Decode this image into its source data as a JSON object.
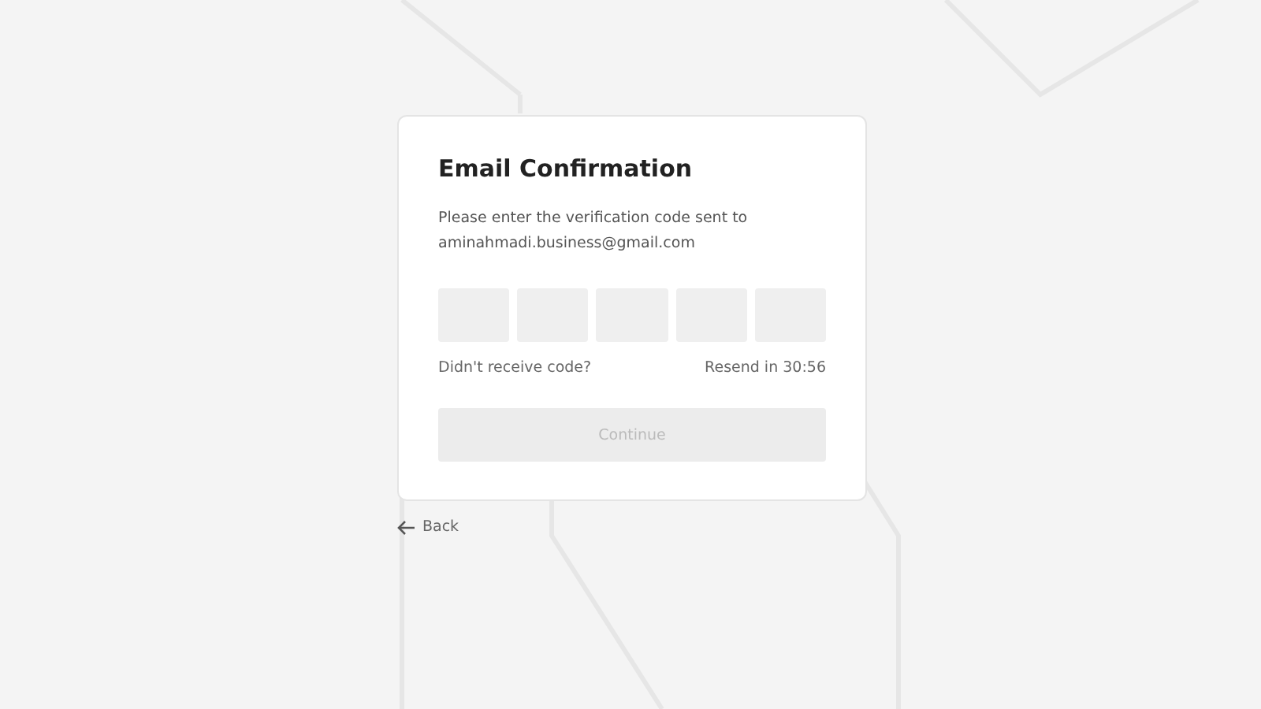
{
  "card": {
    "title": "Email Confirmation",
    "instruction": "Please enter the verification code sent to",
    "email": "aminahmadi.business@gmail.com",
    "code_inputs": [
      {
        "focused": false
      },
      {
        "focused": false
      },
      {
        "focused": false
      },
      {
        "focused": false
      },
      {
        "focused": false
      }
    ],
    "resend_prompt": "Didn't receive code?",
    "resend_timer": "Resend in 30:56",
    "continue_button": {
      "label": "Continue",
      "disabled": true
    }
  },
  "back_link": {
    "label": "Back"
  }
}
